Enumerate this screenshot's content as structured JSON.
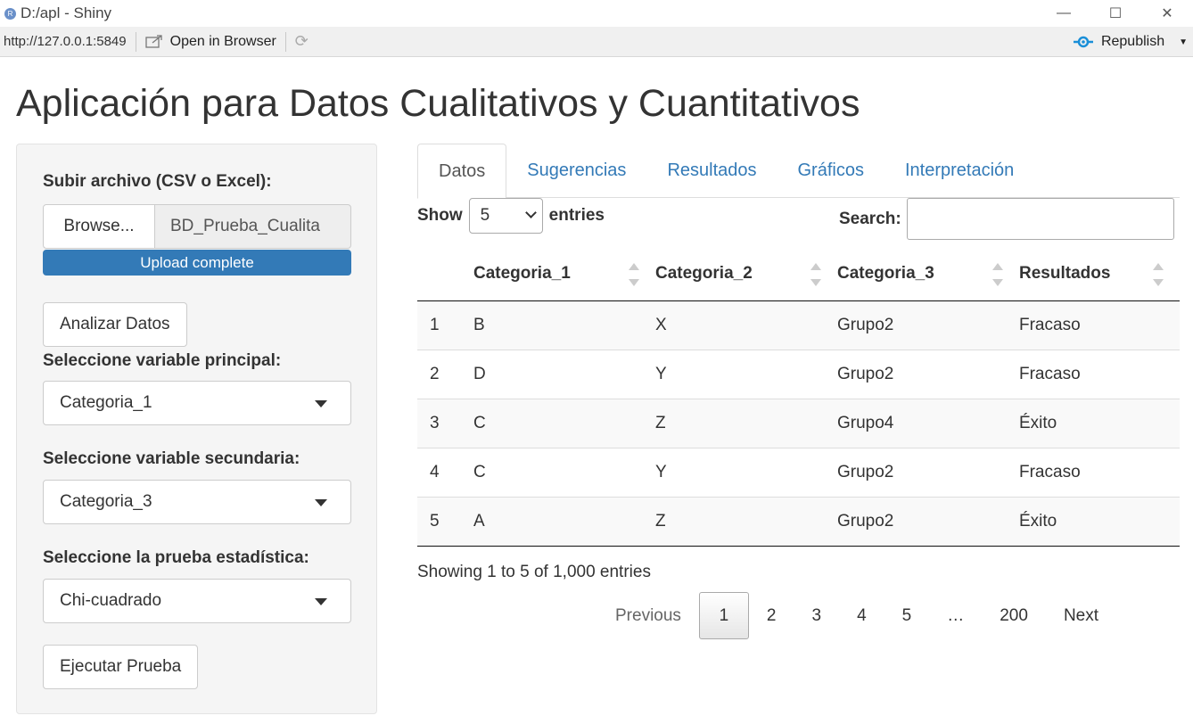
{
  "window": {
    "title": "D:/apl - Shiny",
    "minimize": "—",
    "maximize": "☐",
    "close": "✕"
  },
  "toolbar": {
    "url": "http://127.0.0.1:5849",
    "open_in_browser": "Open in Browser",
    "republish": "Republish"
  },
  "page": {
    "title": "Aplicación para Datos Cualitativos y Cuantitativos"
  },
  "sidebar": {
    "upload_label": "Subir archivo (CSV o Excel):",
    "browse_button": "Browse...",
    "file_name": "BD_Prueba_Cualita",
    "upload_status": "Upload complete",
    "upload_progress": 1.0,
    "analyze_button": "Analizar Datos",
    "primary_label": "Seleccione variable principal:",
    "primary_value": "Categoria_1",
    "secondary_label": "Seleccione variable secundaria:",
    "secondary_value": "Categoria_3",
    "test_label": "Seleccione la prueba estadística:",
    "test_value": "Chi-cuadrado",
    "run_button": "Ejecutar Prueba"
  },
  "tabs": [
    {
      "label": "Datos",
      "active": true
    },
    {
      "label": "Sugerencias",
      "active": false
    },
    {
      "label": "Resultados",
      "active": false
    },
    {
      "label": "Gráficos",
      "active": false
    },
    {
      "label": "Interpretación",
      "active": false
    }
  ],
  "table_controls": {
    "show": "Show",
    "length": "5",
    "entries": "entries",
    "search_label": "Search:",
    "search_value": ""
  },
  "table": {
    "headers": [
      "",
      "Categoria_1",
      "Categoria_2",
      "Categoria_3",
      "Resultados"
    ],
    "rows": [
      [
        "1",
        "B",
        "X",
        "Grupo2",
        "Fracaso"
      ],
      [
        "2",
        "D",
        "Y",
        "Grupo2",
        "Fracaso"
      ],
      [
        "3",
        "C",
        "Z",
        "Grupo4",
        "Éxito"
      ],
      [
        "4",
        "C",
        "Y",
        "Grupo2",
        "Fracaso"
      ],
      [
        "5",
        "A",
        "Z",
        "Grupo2",
        "Éxito"
      ]
    ]
  },
  "info": "Showing 1 to 5 of 1,000 entries",
  "pagination": {
    "previous": "Previous",
    "pages": [
      "1",
      "2",
      "3",
      "4",
      "5",
      "…",
      "200"
    ],
    "current": "1",
    "next": "Next"
  },
  "colors": {
    "accent": "#337ab7",
    "sidebar_bg": "#f5f5f5"
  }
}
